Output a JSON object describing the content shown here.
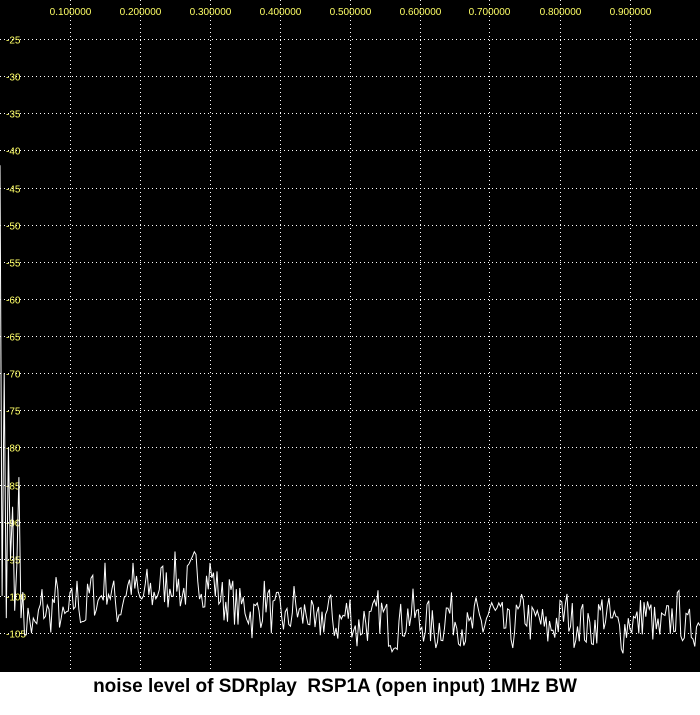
{
  "caption": "noise level of SDRplay  RSP1A (open input) 1MHz BW",
  "colors": {
    "background": "#000000",
    "x_tick_label": "#ffff66",
    "y_tick_label": "#ffff66",
    "grid": "#ffffff",
    "trace": "#ffffff"
  },
  "chart_data": {
    "type": "line",
    "title": "",
    "xlabel": "",
    "ylabel": "",
    "xlim": [
      0.0,
      1.0
    ],
    "ylim": [
      -108,
      -20
    ],
    "grid": true,
    "x_tick_labels": [
      "0.100000",
      "0.200000",
      "0.300000",
      "0.400000",
      "0.500000",
      "0.600000",
      "0.700000",
      "0.800000",
      "0.900000"
    ],
    "x_ticks": [
      0.1,
      0.2,
      0.3,
      0.4,
      0.5,
      0.6,
      0.7,
      0.8,
      0.9
    ],
    "y_tick_labels": [
      "-25",
      "-30",
      "-35",
      "-40",
      "-45",
      "-50",
      "-55",
      "-60",
      "-65",
      "-70",
      "-75",
      "-80",
      "-85",
      "-90",
      "-95",
      "-100",
      "-105"
    ],
    "y_ticks": [
      -25,
      -30,
      -35,
      -40,
      -45,
      -50,
      -55,
      -60,
      -65,
      -70,
      -75,
      -80,
      -85,
      -90,
      -95,
      -100,
      -105
    ],
    "series": [
      {
        "x": [
          0.0,
          0.003,
          0.006,
          0.009,
          0.012,
          0.015,
          0.018,
          0.021,
          0.024,
          0.027,
          0.03,
          0.035,
          0.04,
          0.05,
          0.06,
          0.07,
          0.08,
          0.09,
          0.1,
          0.11,
          0.12,
          0.13,
          0.14,
          0.15,
          0.16,
          0.17,
          0.18,
          0.19,
          0.2,
          0.21,
          0.22,
          0.23,
          0.24,
          0.25,
          0.26,
          0.27,
          0.28,
          0.29,
          0.3,
          0.31,
          0.32,
          0.33,
          0.34,
          0.35,
          0.36,
          0.37,
          0.38,
          0.39,
          0.4,
          0.41,
          0.42,
          0.43,
          0.44,
          0.45,
          0.46,
          0.47,
          0.48,
          0.49,
          0.5,
          0.51,
          0.52,
          0.53,
          0.54,
          0.55,
          0.56,
          0.57,
          0.58,
          0.59,
          0.6,
          0.61,
          0.62,
          0.63,
          0.64,
          0.65,
          0.66,
          0.67,
          0.68,
          0.69,
          0.7,
          0.71,
          0.72,
          0.73,
          0.74,
          0.75,
          0.76,
          0.77,
          0.78,
          0.79,
          0.8,
          0.81,
          0.82,
          0.83,
          0.84,
          0.85,
          0.86,
          0.87,
          0.88,
          0.89,
          0.9,
          0.91,
          0.92,
          0.93,
          0.94,
          0.95,
          0.96,
          0.97,
          0.98,
          0.99,
          1.0
        ],
        "values": [
          -42,
          -100,
          -70,
          -103,
          -80,
          -95,
          -88,
          -102,
          -96,
          -84,
          -100,
          -104,
          -103,
          -105,
          -101,
          -103,
          -100,
          -104,
          -102,
          -100,
          -103,
          -99,
          -101,
          -98,
          -100,
          -102,
          -99,
          -98,
          -101,
          -99,
          -100,
          -98,
          -99,
          -97,
          -100,
          -98,
          -96,
          -99,
          -97,
          -99,
          -101,
          -100,
          -102,
          -101,
          -103,
          -102,
          -100,
          -103,
          -102,
          -104,
          -101,
          -103,
          -102,
          -105,
          -103,
          -102,
          -104,
          -103,
          -102,
          -105,
          -103,
          -104,
          -102,
          -103,
          -105,
          -104,
          -103,
          -102,
          -104,
          -103,
          -105,
          -104,
          -102,
          -103,
          -104,
          -105,
          -103,
          -104,
          -102,
          -103,
          -104,
          -105,
          -103,
          -102,
          -104,
          -103,
          -105,
          -104,
          -103,
          -102,
          -104,
          -103,
          -105,
          -104,
          -102,
          -103,
          -104,
          -105,
          -103,
          -104,
          -102,
          -103,
          -105,
          -104,
          -103,
          -102,
          -105,
          -104,
          -104
        ]
      }
    ]
  }
}
